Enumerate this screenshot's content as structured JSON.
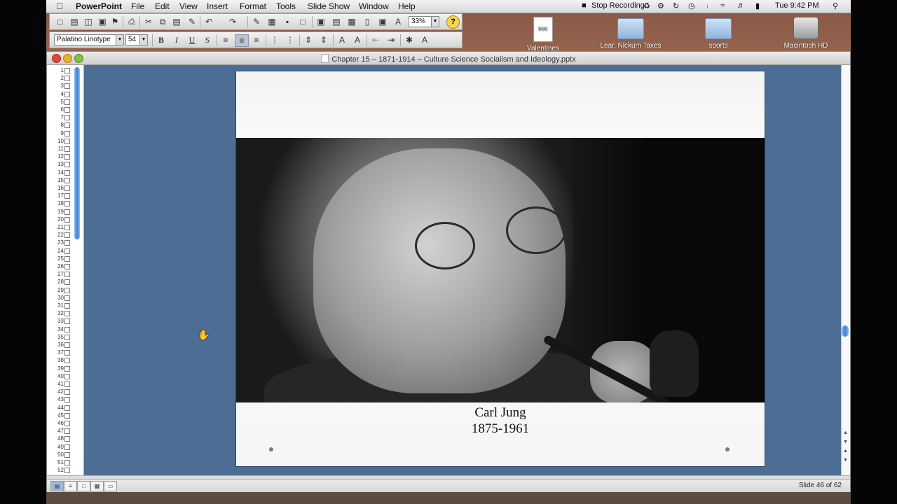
{
  "menubar": {
    "app": "PowerPoint",
    "items": [
      "File",
      "Edit",
      "View",
      "Insert",
      "Format",
      "Tools",
      "Slide Show",
      "Window",
      "Help"
    ],
    "recording": "Stop Recording",
    "clock": "Tue 9:42 PM"
  },
  "toolbar": {
    "zoom": "33%",
    "font_name": "Palatino Linotype",
    "font_size": "54",
    "bold": "B",
    "italic": "I",
    "underline": "U",
    "shadow": "S"
  },
  "desktop": {
    "icons": [
      {
        "label": "Valentines",
        "kind": "doc",
        "tag": "DOC"
      },
      {
        "label": "Lear, Nickum Taxes",
        "kind": "folder"
      },
      {
        "label": "sports",
        "kind": "folder"
      },
      {
        "label": "Macintosh HD",
        "kind": "disk"
      }
    ]
  },
  "window": {
    "title": "Chapter 15 – 1871-1914 – Culture Science Socialism and Ideology.pptx"
  },
  "outline": {
    "slide_numbers": [
      "1",
      "2",
      "3",
      "4",
      "5",
      "6",
      "7",
      "8",
      "9",
      "10",
      "11",
      "12",
      "13",
      "14",
      "15",
      "16",
      "17",
      "18",
      "19",
      "20",
      "21",
      "22",
      "23",
      "24",
      "25",
      "26",
      "27",
      "28",
      "29",
      "30",
      "31",
      "32",
      "33",
      "34",
      "35",
      "36",
      "37",
      "38",
      "39",
      "40",
      "41",
      "42",
      "43",
      "44",
      "45",
      "46",
      "47",
      "48",
      "49",
      "50",
      "51",
      "52"
    ]
  },
  "slide": {
    "caption_name": "Carl Jung",
    "caption_years": "1875-1961"
  },
  "status": {
    "slide_info": "Slide 46 of 62"
  }
}
